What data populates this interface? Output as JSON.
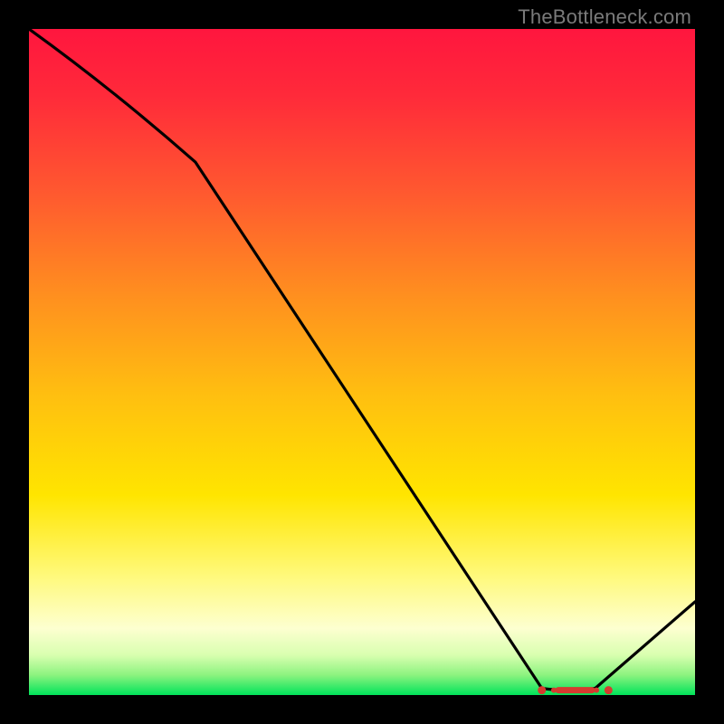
{
  "watermark": "TheBottleneck.com",
  "chart_data": {
    "type": "line",
    "title": "",
    "xlabel": "",
    "ylabel": "",
    "xlim": [
      0,
      100
    ],
    "ylim": [
      0,
      100
    ],
    "grid": false,
    "legend": false,
    "background_gradient_top": "#ff183f",
    "background_gradient_mid": "#ffe400",
    "background_gradient_bottom": "#00e35a",
    "x": [
      0,
      25,
      77,
      85,
      100
    ],
    "values": [
      100,
      80,
      1,
      1,
      14
    ],
    "notes": "Single black curve over a vertical heat gradient (red→orange→yellow→pale→green). The curve starts top-left, drops steeply to a flat green minimum around x≈77–85, then rises toward the right edge.",
    "flat_segment": {
      "x_start": 77,
      "x_end": 87,
      "y": 1,
      "marker": "red-dash-cluster"
    },
    "colors": {
      "line": "#000000",
      "marker": "#d63b2f"
    }
  }
}
